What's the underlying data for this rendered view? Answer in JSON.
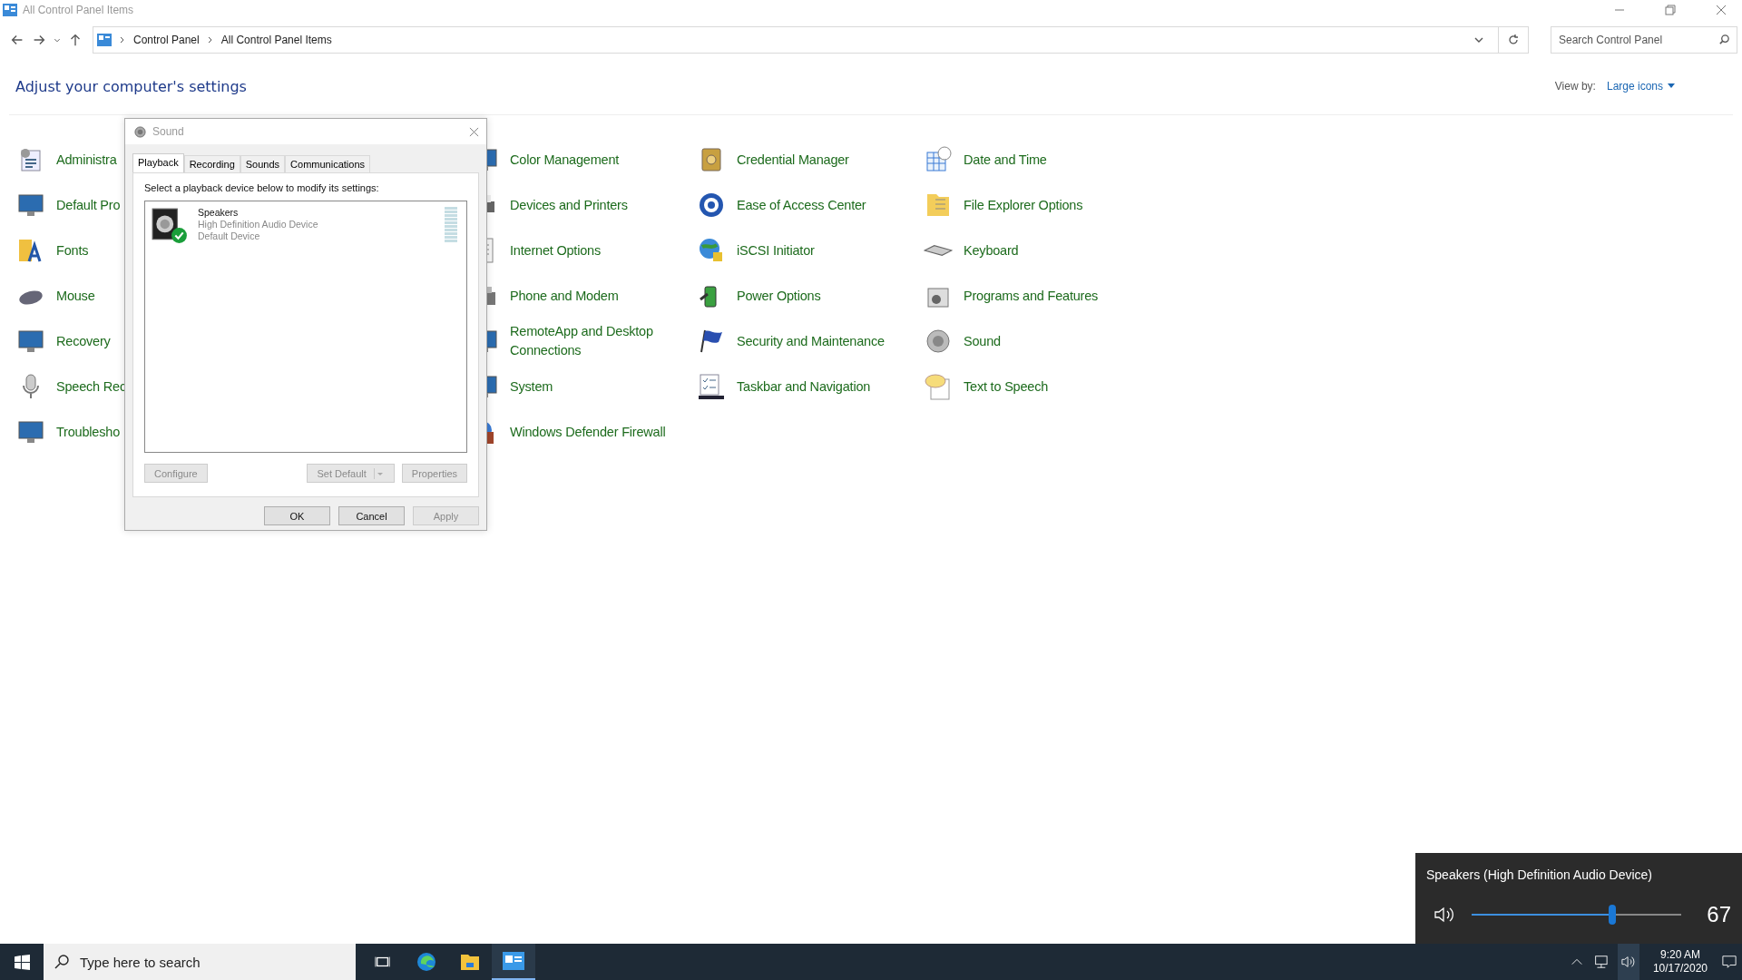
{
  "window": {
    "title": "All Control Panel Items"
  },
  "address_bar": {
    "path": [
      "Control Panel",
      "All Control Panel Items"
    ]
  },
  "search": {
    "placeholder": "Search Control Panel"
  },
  "heading": "Adjust your computer's settings",
  "view_by": {
    "label": "View by:",
    "value": "Large icons"
  },
  "columns": [
    {
      "items": [
        "Administra",
        "Default Pro",
        "Fonts",
        "Mouse",
        "Recovery",
        "Speech Rec",
        "Troublesho"
      ]
    },
    {
      "items": [
        "Color Management",
        "Devices and Printers",
        "Internet Options",
        "Phone and Modem",
        "RemoteApp and Desktop Connections",
        "System",
        "Windows Defender Firewall"
      ]
    },
    {
      "items": [
        "Credential Manager",
        "Ease of Access Center",
        "iSCSI Initiator",
        "Power Options",
        "Security and Maintenance",
        "Taskbar and Navigation"
      ]
    },
    {
      "items": [
        "Date and Time",
        "File Explorer Options",
        "Keyboard",
        "Programs and Features",
        "Sound",
        "Text to Speech"
      ]
    }
  ],
  "dialog": {
    "title": "Sound",
    "tabs": [
      {
        "label": "Playback",
        "selected": true
      },
      {
        "label": "Recording",
        "selected": false
      },
      {
        "label": "Sounds",
        "selected": false
      },
      {
        "label": "Communications",
        "selected": false
      }
    ],
    "instruction": "Select a playback device below to modify its settings:",
    "devices": [
      {
        "name": "Speakers",
        "description": "High Definition Audio Device",
        "status": "Default Device",
        "default": true
      }
    ],
    "device_buttons": [
      {
        "label": "Configure",
        "disabled": true,
        "kind": "plain"
      },
      {
        "label": "Set Default",
        "disabled": true,
        "kind": "split"
      },
      {
        "label": "Properties",
        "disabled": true,
        "kind": "plain"
      }
    ],
    "buttons": [
      {
        "label": "OK",
        "disabled": false
      },
      {
        "label": "Cancel",
        "disabled": false
      },
      {
        "label": "Apply",
        "disabled": true
      }
    ]
  },
  "volume_flyout": {
    "device": "Speakers (High Definition Audio Device)",
    "level": 0.67,
    "reading": "67"
  },
  "taskbar": {
    "search_placeholder": "Type here to search",
    "time": "9:20 AM",
    "date": "10/17/2020"
  }
}
